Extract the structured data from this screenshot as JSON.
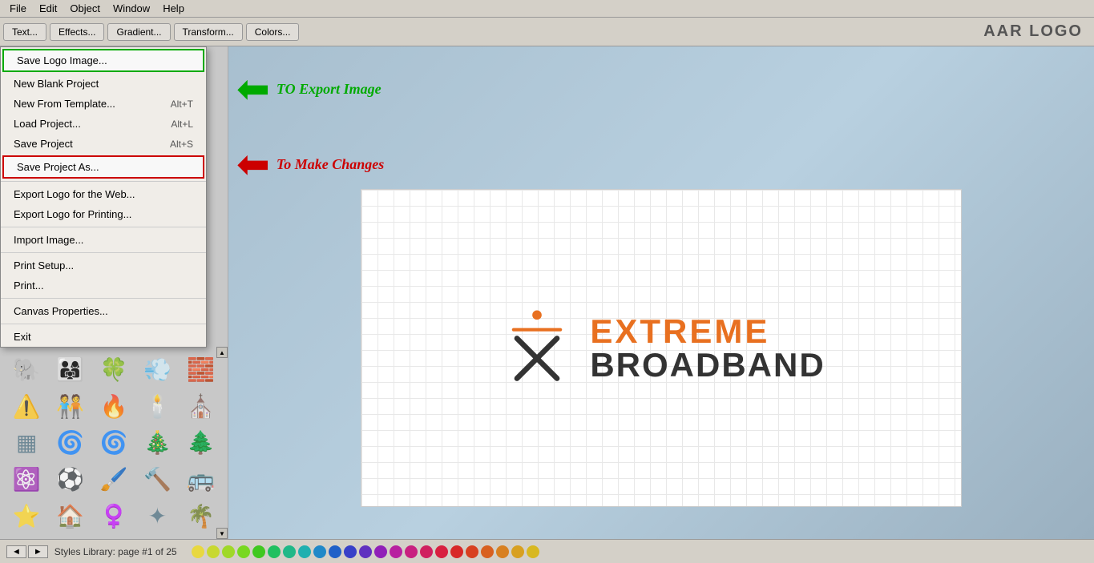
{
  "app": {
    "title": "AAR LOGO",
    "menubar": {
      "items": [
        {
          "label": "File",
          "id": "file"
        },
        {
          "label": "Edit",
          "id": "edit"
        },
        {
          "label": "Object",
          "id": "object"
        },
        {
          "label": "Window",
          "id": "window"
        },
        {
          "label": "Help",
          "id": "help"
        }
      ]
    },
    "toolbar": {
      "buttons": [
        {
          "label": "Text...",
          "id": "text-btn"
        },
        {
          "label": "Effects...",
          "id": "effects-btn"
        },
        {
          "label": "Gradient...",
          "id": "gradient-btn"
        },
        {
          "label": "Transform...",
          "id": "transform-btn"
        },
        {
          "label": "Colors...",
          "id": "colors-btn"
        }
      ]
    }
  },
  "dropdown": {
    "items": [
      {
        "label": "Save Logo Image...",
        "shortcut": "",
        "id": "save-logo",
        "highlighted": "green"
      },
      {
        "label": "New Blank Project",
        "shortcut": "",
        "id": "new-blank"
      },
      {
        "label": "New From Template...",
        "shortcut": "Alt+T",
        "id": "new-template"
      },
      {
        "label": "Load Project...",
        "shortcut": "Alt+L",
        "id": "load-project"
      },
      {
        "label": "Save Project",
        "shortcut": "Alt+S",
        "id": "save-project"
      },
      {
        "label": "Save Project As...",
        "shortcut": "",
        "id": "save-project-as",
        "highlighted": "red"
      },
      {
        "label": "Export Logo for the Web...",
        "shortcut": "",
        "id": "export-web"
      },
      {
        "label": "Export Logo for Printing...",
        "shortcut": "",
        "id": "export-print"
      },
      {
        "label": "Import Image...",
        "shortcut": "",
        "id": "import-image"
      },
      {
        "label": "Print Setup...",
        "shortcut": "",
        "id": "print-setup"
      },
      {
        "label": "Print...",
        "shortcut": "",
        "id": "print"
      },
      {
        "label": "Canvas Properties...",
        "shortcut": "",
        "id": "canvas-props"
      },
      {
        "label": "Exit",
        "shortcut": "",
        "id": "exit"
      }
    ]
  },
  "annotations": {
    "green": {
      "text": "TO Export Image",
      "direction": "left"
    },
    "red": {
      "text": "To Make Changes",
      "direction": "left"
    }
  },
  "logo": {
    "extreme": "EXTREME",
    "broadband": "BROADBAND"
  },
  "statusbar": {
    "page_info": "Styles Library: page #1 of 25"
  },
  "palette": {
    "colors": [
      "#e8d840",
      "#c8d830",
      "#a0d828",
      "#78d820",
      "#40c820",
      "#20c060",
      "#20b888",
      "#20b0b0",
      "#2088c8",
      "#2060c8",
      "#3840c8",
      "#6030c0",
      "#9020b8",
      "#b820a0",
      "#c82080",
      "#d02060",
      "#d82040",
      "#d82828",
      "#d84020",
      "#d86020",
      "#d88020",
      "#d8a020",
      "#d8b820"
    ]
  }
}
